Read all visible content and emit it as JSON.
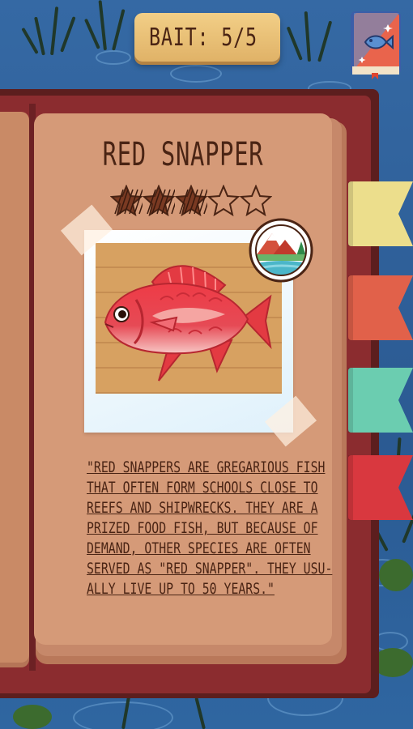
{
  "hud": {
    "bait_label": "BAIT: 5/5",
    "bait_icon": "lure-icon",
    "journal_icon": "fish-journal-icon"
  },
  "fish": {
    "name": "RED SNAPPER",
    "rating": 3,
    "rating_max": 5,
    "habitat_icon": "mountain-lake-icon",
    "description_lines": [
      "\"RED SNAPPERS ARE GREGARIOUS FISH",
      "THAT OFTEN FORM SCHOOLS CLOSE TO",
      "REEFS AND SHIPWRECKS. THEY ARE A",
      "PRIZED FOOD FISH, BUT BECAUSE OF",
      "DEMAND, OTHER SPECIES ARE OFTEN",
      "SERVED AS \"RED SNAPPER\". THEY USU-",
      "ALLY LIVE UP TO 50 YEARS.\""
    ]
  },
  "tabs": [
    {
      "name": "tab-yellow",
      "color": "#ecde8c"
    },
    {
      "name": "tab-orange",
      "color": "#e1614a"
    },
    {
      "name": "tab-teal",
      "color": "#6bcdb0"
    },
    {
      "name": "tab-red",
      "color": "#d9383f"
    }
  ],
  "colors": {
    "page": "#d59a78",
    "cover": "#8b2c2f",
    "ink": "#4a2414",
    "bait_box": "#e8c077"
  }
}
